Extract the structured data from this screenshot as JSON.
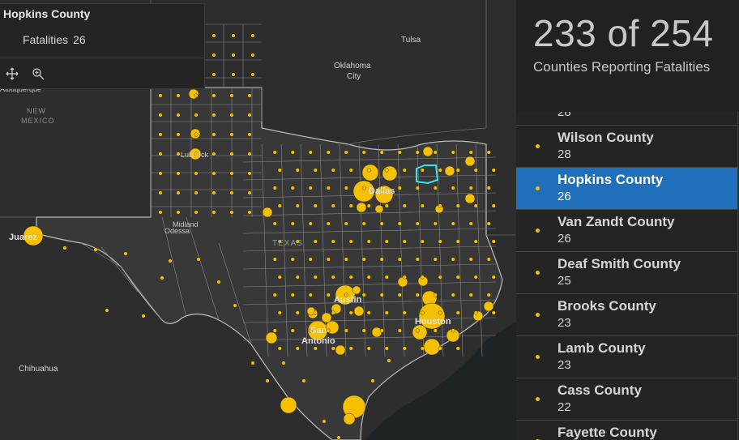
{
  "popup": {
    "title": "Hopkins County",
    "field_label": "Fatalities",
    "field_value": "26",
    "actions": [
      "pan-icon",
      "zoom-to-icon"
    ]
  },
  "stats": {
    "headline": "233 of 254",
    "subtitle": "Counties Reporting Fatalities"
  },
  "list": {
    "partial_top_value": "28",
    "items": [
      {
        "name": "Wilson County",
        "count": "28",
        "selected": false
      },
      {
        "name": "Hopkins County",
        "count": "26",
        "selected": true
      },
      {
        "name": "Van Zandt County",
        "count": "26",
        "selected": false
      },
      {
        "name": "Deaf Smith County",
        "count": "25",
        "selected": false
      },
      {
        "name": "Brooks County",
        "count": "23",
        "selected": false
      },
      {
        "name": "Lamb County",
        "count": "23",
        "selected": false
      },
      {
        "name": "Cass County",
        "count": "22",
        "selected": false
      },
      {
        "name": "Fayette County",
        "count": "",
        "selected": false
      }
    ]
  },
  "map": {
    "labels": {
      "tulsa": "Tulsa",
      "oklahoma": "Oklahoma",
      "city": "City",
      "albuquerque": "Albuquerque",
      "new": "NEW",
      "mexico": "MEXICO",
      "lubbock": "Lubbock",
      "midland": "Midland",
      "odessa": "Odessa",
      "juarez": "Juarez",
      "texas": "TEXAS",
      "dallas": "Dallas",
      "austin": "Austin",
      "san": "San",
      "antonio": "Antonio",
      "houston": "Houston",
      "chihuahua": "Chihuahua"
    },
    "colors": {
      "land": "#2f2f2f",
      "state": "#383838",
      "water": "#1e2326",
      "marker": "#f5c000",
      "highlight": "#33e6f0"
    }
  }
}
